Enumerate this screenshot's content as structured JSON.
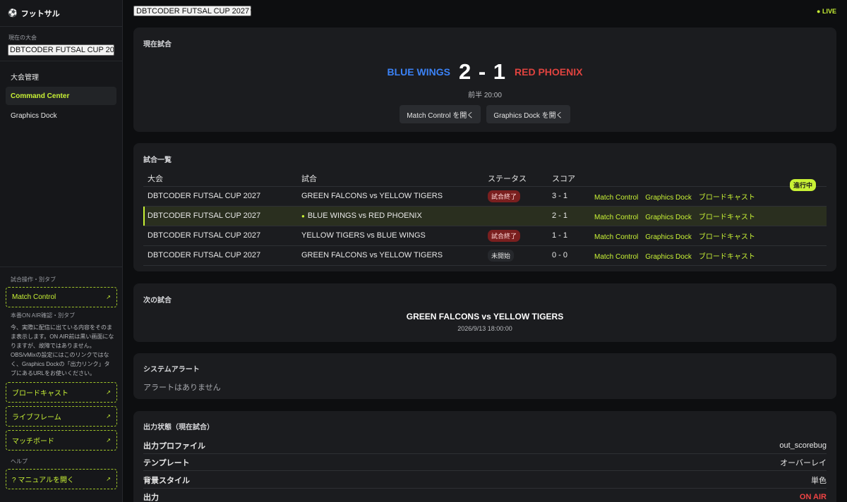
{
  "app": {
    "brand": "フットサル"
  },
  "sidebar": {
    "tournament_label": "現在の大会",
    "tournament_select": "DBTCODER FUTSAL CUP 2027",
    "nav": [
      {
        "label": "大会管理"
      },
      {
        "label": "Command Center",
        "active": true
      },
      {
        "label": "Graphics Dock"
      }
    ],
    "ops_label": "試合操作・別タブ",
    "match_control": "Match Control",
    "onair_label": "本番ON AIR確認・別タブ",
    "onair_note": "今、実際に配信に出ている内容をそのまま表示します。ON AIR前は黒い画面になりますが、故障ではありません。OBS/vMixの設定にはこのリンクではなく、Graphics Dockの「出力リンク」タブにあるURLをお使いください。",
    "broadcast": "ブロードキャスト",
    "liveframe": "ライブフレーム",
    "matchboard": "マッチボード",
    "help_label": "ヘルプ",
    "manual": "? マニュアルを開く"
  },
  "header": {
    "tournament_select": "DBTCODER FUTSAL CUP 2027",
    "live": "● LIVE"
  },
  "current_match": {
    "title": "現在試合",
    "home": "BLUE WINGS",
    "away": "RED PHOENIX",
    "score": "2 - 1",
    "period": "前半 20:00",
    "btn_match_control": "Match Control を開く",
    "btn_graphics_dock": "Graphics Dock を開く"
  },
  "match_list": {
    "title": "試合一覧",
    "columns": [
      "大会",
      "試合",
      "ステータス",
      "スコア"
    ],
    "link_labels": {
      "match_control": "Match Control",
      "graphics_dock": "Graphics Dock",
      "broadcast": "ブロードキャスト"
    },
    "rows": [
      {
        "tournament": "DBTCODER FUTSAL CUP 2027",
        "match": "GREEN FALCONS vs YELLOW TIGERS",
        "status": "試合終了",
        "score": "3 - 1"
      },
      {
        "tournament": "DBTCODER FUTSAL CUP 2027",
        "match": "BLUE WINGS vs RED PHOENIX",
        "status": "進行中",
        "score": "2 - 1"
      },
      {
        "tournament": "DBTCODER FUTSAL CUP 2027",
        "match": "YELLOW TIGERS vs BLUE WINGS",
        "status": "試合終了",
        "score": "1 - 1"
      },
      {
        "tournament": "DBTCODER FUTSAL CUP 2027",
        "match": "GREEN FALCONS vs YELLOW TIGERS",
        "status": "未開始",
        "score": "0 - 0"
      }
    ]
  },
  "next_match": {
    "title": "次の試合",
    "match": "GREEN FALCONS vs YELLOW TIGERS",
    "time": "2026/9/13 18:00:00"
  },
  "alerts": {
    "title": "システムアラート",
    "empty": "アラートはありません"
  },
  "output": {
    "title": "出力状態（現在試合）",
    "rows": [
      {
        "key": "出力プロファイル",
        "value": "out_scorebug"
      },
      {
        "key": "テンプレート",
        "value": "オーバーレイ"
      },
      {
        "key": "背景スタイル",
        "value": "単色"
      },
      {
        "key": "出力",
        "value": "ON AIR"
      }
    ]
  },
  "colors": {
    "accent": "#c8f135",
    "home": "#3b82f6",
    "away": "#e0433f",
    "onair": "#ef4444"
  }
}
